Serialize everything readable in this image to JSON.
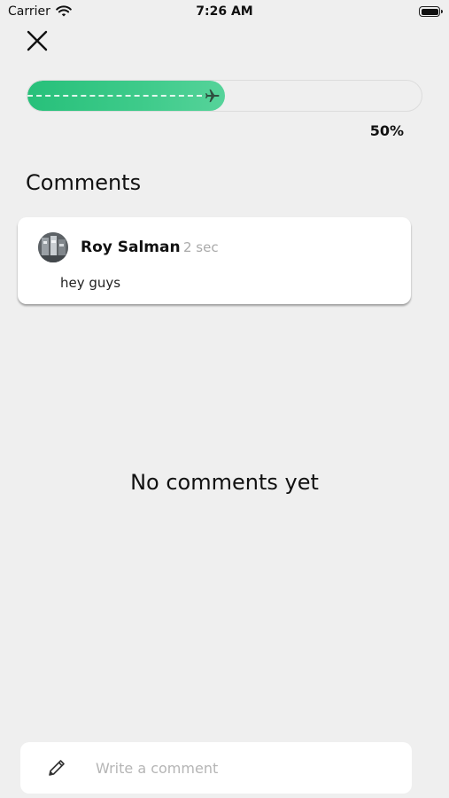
{
  "status_bar": {
    "carrier": "Carrier",
    "time": "7:26 AM"
  },
  "progress": {
    "value": 0.5,
    "label": "50%",
    "fill_color": "#27c07a"
  },
  "comments_section": {
    "title": "Comments",
    "items": [
      {
        "author": "Roy Salman",
        "time": "2 sec",
        "text": "hey guys"
      }
    ]
  },
  "empty_state": {
    "message": "No comments yet"
  },
  "composer": {
    "placeholder": "Write a comment",
    "value": ""
  },
  "icons": {
    "close": "close-icon",
    "plane": "airplane-icon",
    "pencil": "pencil-icon",
    "wifi": "wifi-icon",
    "battery": "battery-icon"
  }
}
